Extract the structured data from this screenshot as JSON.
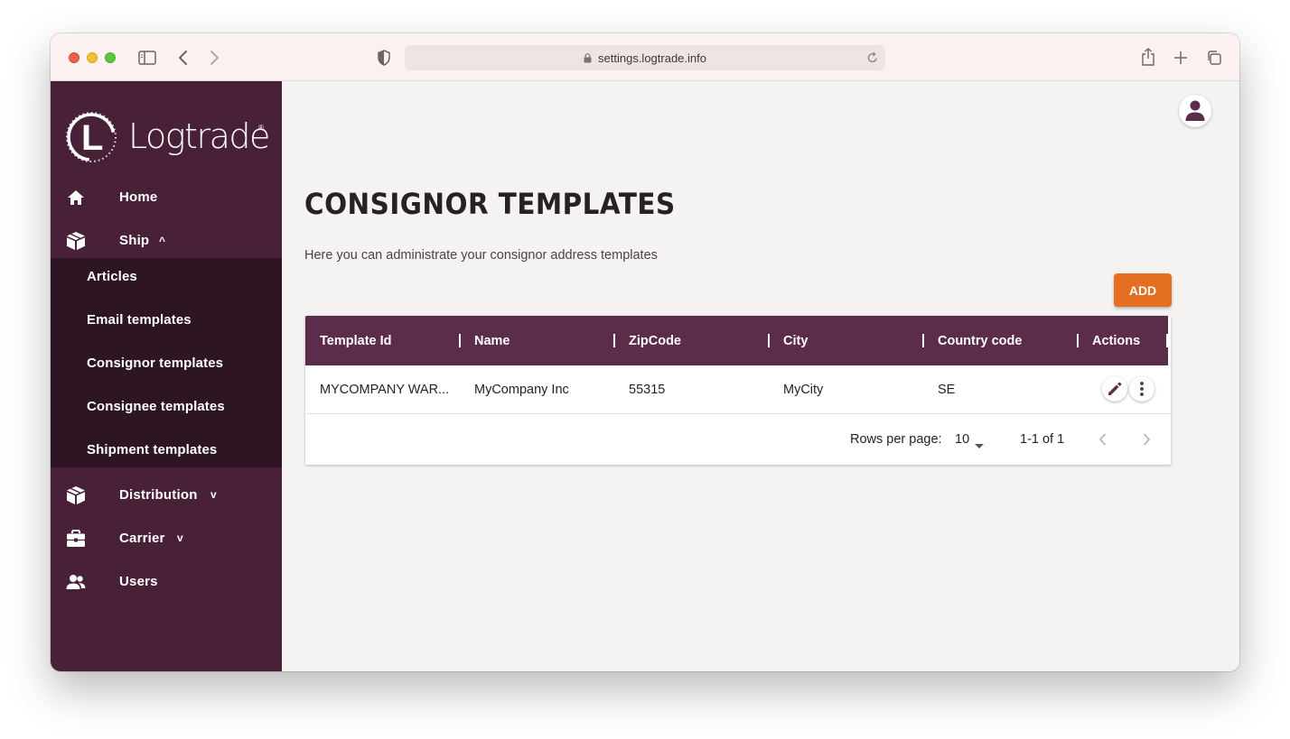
{
  "browser": {
    "url": "settings.logtrade.info"
  },
  "sidebar": {
    "logo_text": "Logtrade",
    "logo_mark": "L",
    "logo_reg": "®",
    "items": [
      {
        "label": "Home",
        "icon": "home-icon"
      },
      {
        "label": "Ship",
        "icon": "box-icon",
        "chevron": "^"
      },
      {
        "label": "Distribution",
        "icon": "box-icon",
        "chevron": "v"
      },
      {
        "label": "Carrier",
        "icon": "briefcase-icon",
        "chevron": "v"
      },
      {
        "label": "Users",
        "icon": "users-icon"
      }
    ],
    "ship_submenu": [
      {
        "label": "Articles"
      },
      {
        "label": "Email templates"
      },
      {
        "label": "Consignor templates"
      },
      {
        "label": "Consignee templates"
      },
      {
        "label": "Shipment templates"
      }
    ]
  },
  "main": {
    "title": "CONSIGNOR TEMPLATES",
    "description": "Here you can administrate your consignor address templates",
    "add_label": "ADD",
    "table": {
      "columns": [
        "Template Id",
        "Name",
        "ZipCode",
        "City",
        "Country code",
        "Actions"
      ],
      "rows": [
        [
          "MYCOMPANY WAR...",
          "MyCompany Inc",
          "55315",
          "MyCity",
          "SE"
        ]
      ]
    },
    "pagination": {
      "rows_per_page_label": "Rows per page:",
      "rows_per_page_value": "10",
      "range": "1-1 of 1"
    }
  },
  "colors": {
    "sidebar": "#482038",
    "submenu": "#2d1524",
    "table_header": "#5b2d4b",
    "accent": "#e56f21"
  }
}
